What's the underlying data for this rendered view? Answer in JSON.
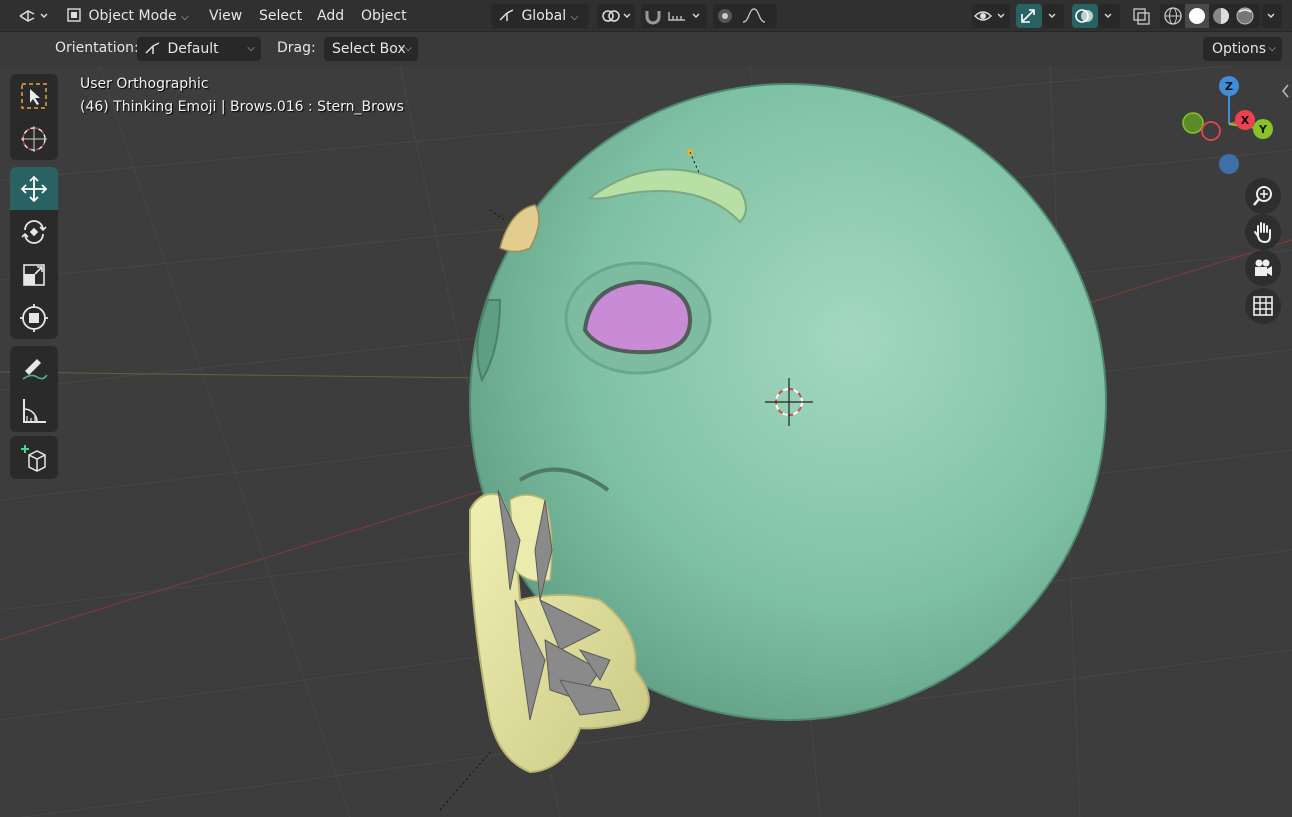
{
  "header": {
    "editor_type_icon": "view3d-icon",
    "mode": "Object Mode",
    "menus": [
      "View",
      "Select",
      "Add",
      "Object"
    ],
    "transform_orientation": "Global",
    "pivot_icon": "pivot-icon",
    "snap_icon": "magnet-icon",
    "proportional_icon": "proportional-icon",
    "visibility_icon": "eye-icon",
    "gizmo_icon": "gizmo-icon",
    "overlay_icon": "overlay-icon",
    "xray_icon": "xray-icon",
    "shading_modes": [
      "wireframe",
      "solid",
      "material",
      "rendered"
    ],
    "active_shading": "solid"
  },
  "tool_header": {
    "orientation_label": "Orientation:",
    "orientation_value": "Default",
    "drag_label": "Drag:",
    "drag_value": "Select Box",
    "options_label": "Options"
  },
  "viewport": {
    "view_name": "User Orthographic",
    "object_info": "(46) Thinking Emoji | Brows.016 : Stern_Brows"
  },
  "toolbar": {
    "tools": [
      "select-box",
      "cursor",
      "move",
      "rotate",
      "scale",
      "transform",
      "annotate",
      "measure",
      "add-cube"
    ],
    "active_tool": "move"
  },
  "gizmo": {
    "axes": [
      "Z",
      "X",
      "Y"
    ],
    "colors": {
      "x": "#e8434f",
      "y": "#88c22a",
      "z": "#3f8ed8"
    }
  },
  "navigation": [
    "zoom-icon",
    "hand-icon",
    "camera-icon",
    "grid-icon"
  ],
  "colors": {
    "accent": "#286262",
    "header_bg": "#303030",
    "viewport_bg": "#3d3d3d",
    "sphere": "#83c7a8",
    "hand": "#e3e39c",
    "eye": "#c98ad6"
  }
}
